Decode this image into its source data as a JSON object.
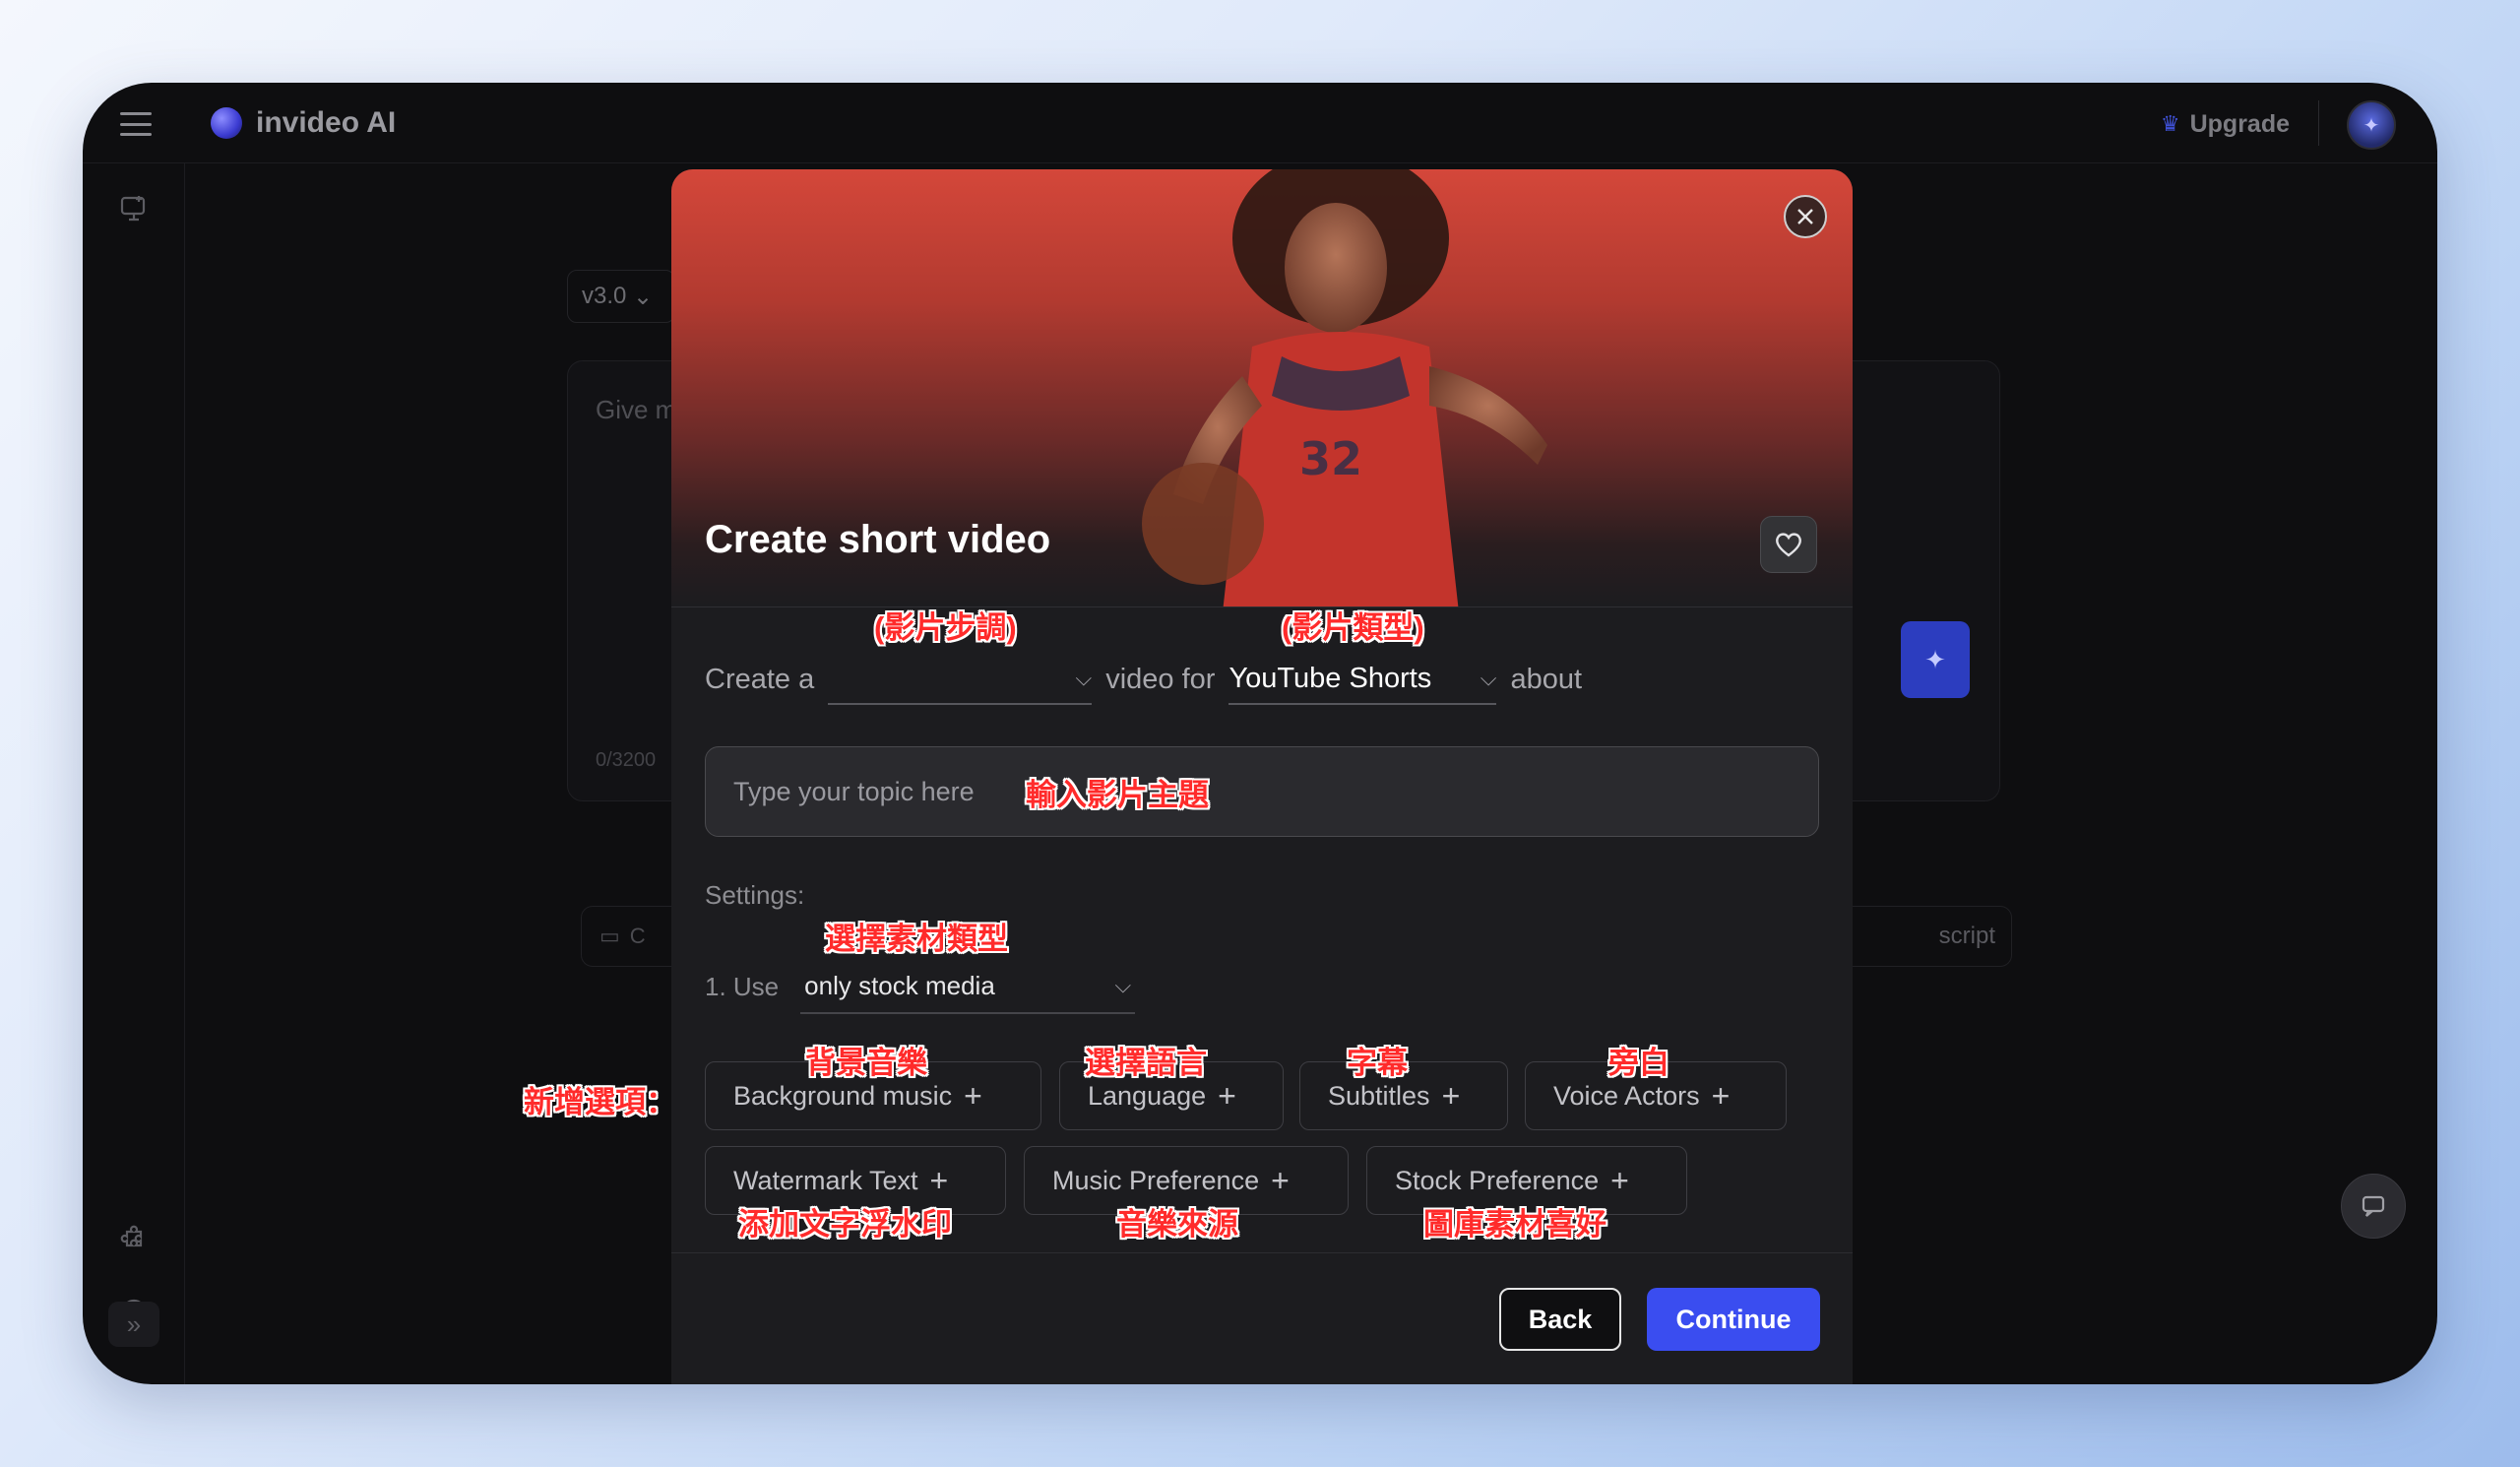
{
  "app": {
    "name": "invideo AI",
    "upgrade_label": "Upgrade"
  },
  "background_page": {
    "version_label": "v3.0",
    "prompt_placeholder": "Give m",
    "char_counter": "0/3200",
    "chip_left_label": "C",
    "chip_right_label": "script"
  },
  "modal": {
    "title": "Create short video",
    "sentence": {
      "prefix": "Create a",
      "pace_value": "",
      "middle": "video for",
      "platform_value": "YouTube Shorts",
      "suffix": "about"
    },
    "topic_placeholder": "Type your topic here",
    "settings_label": "Settings:",
    "use_label": "1. Use",
    "media_value": "only stock media",
    "options": [
      {
        "label": "Background music"
      },
      {
        "label": "Language"
      },
      {
        "label": "Subtitles"
      },
      {
        "label": "Voice Actors"
      },
      {
        "label": "Watermark Text"
      },
      {
        "label": "Music Preference"
      },
      {
        "label": "Stock Preference"
      }
    ],
    "back_label": "Back",
    "continue_label": "Continue"
  },
  "annotations": {
    "pace": "(影片步調)",
    "type": "(影片類型)",
    "topic": "輸入影片主題",
    "media_type": "選擇素材類型",
    "add_options": "新增選項：",
    "background_music": "背景音樂",
    "language": "選擇語言",
    "subtitles": "字幕",
    "voice": "旁白",
    "watermark": "添加文字浮水印",
    "music_source": "音樂來源",
    "stock_pref": "圖庫素材喜好"
  },
  "icons": {
    "menu": "hamburger-icon",
    "close": "close-icon",
    "favorite": "heart-icon",
    "chevron": "chevron-down-icon",
    "plus": "plus-icon",
    "crown": "crown-icon",
    "chat": "chat-icon"
  },
  "colors": {
    "accent": "#3a4df0",
    "annotation": "#ff2b2b"
  }
}
